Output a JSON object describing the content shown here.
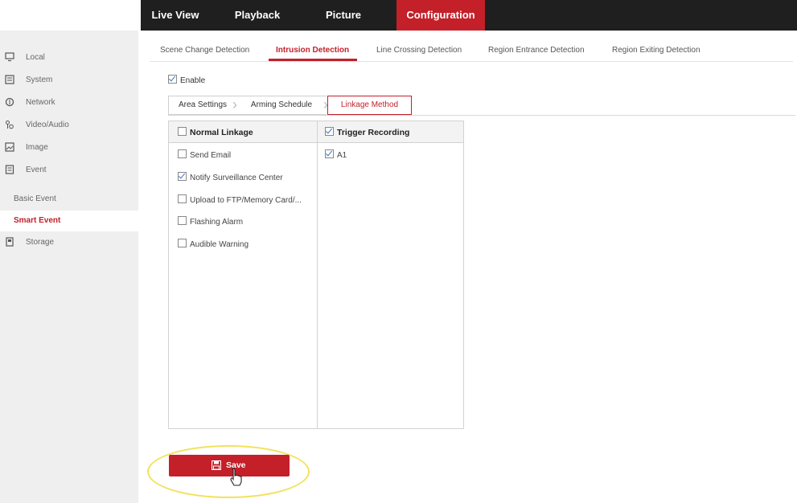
{
  "nav": {
    "tabs": [
      {
        "label": "Live View"
      },
      {
        "label": "Playback"
      },
      {
        "label": "Picture"
      },
      {
        "label": "Configuration",
        "active": true
      }
    ]
  },
  "sidebar": {
    "items": [
      {
        "label": "Local",
        "icon": "monitor-icon"
      },
      {
        "label": "System",
        "icon": "system-icon"
      },
      {
        "label": "Network",
        "icon": "network-icon"
      },
      {
        "label": "Video/Audio",
        "icon": "video-audio-icon"
      },
      {
        "label": "Image",
        "icon": "image-icon"
      },
      {
        "label": "Event",
        "icon": "event-icon"
      },
      {
        "label": "Basic Event"
      },
      {
        "label": "Smart Event",
        "active": true
      },
      {
        "label": "Storage",
        "icon": "storage-icon"
      }
    ]
  },
  "subtabs": [
    {
      "label": "Scene Change Detection"
    },
    {
      "label": "Intrusion Detection",
      "active": true
    },
    {
      "label": "Line Crossing Detection"
    },
    {
      "label": "Region Entrance Detection"
    },
    {
      "label": "Region Exiting Detection"
    }
  ],
  "enable": {
    "label": "Enable",
    "checked": true
  },
  "steps": [
    {
      "label": "Area Settings"
    },
    {
      "label": "Arming Schedule"
    },
    {
      "label": "Linkage Method",
      "active": true
    }
  ],
  "linkage": {
    "normal_title": "Normal Linkage",
    "normal_checked": false,
    "items": [
      {
        "label": "Send Email",
        "checked": false
      },
      {
        "label": "Notify Surveillance Center",
        "checked": true
      },
      {
        "label": "Upload to FTP/Memory Card/...",
        "checked": false
      },
      {
        "label": "Flashing Alarm",
        "checked": false
      },
      {
        "label": "Audible Warning",
        "checked": false
      }
    ],
    "trigger_title": "Trigger Recording",
    "trigger_checked": true,
    "trigger_items": [
      {
        "label": "A1",
        "checked": true
      }
    ]
  },
  "save": {
    "label": "Save"
  },
  "colors": {
    "accent": "#c3202a",
    "highlight": "#f2e25c"
  }
}
